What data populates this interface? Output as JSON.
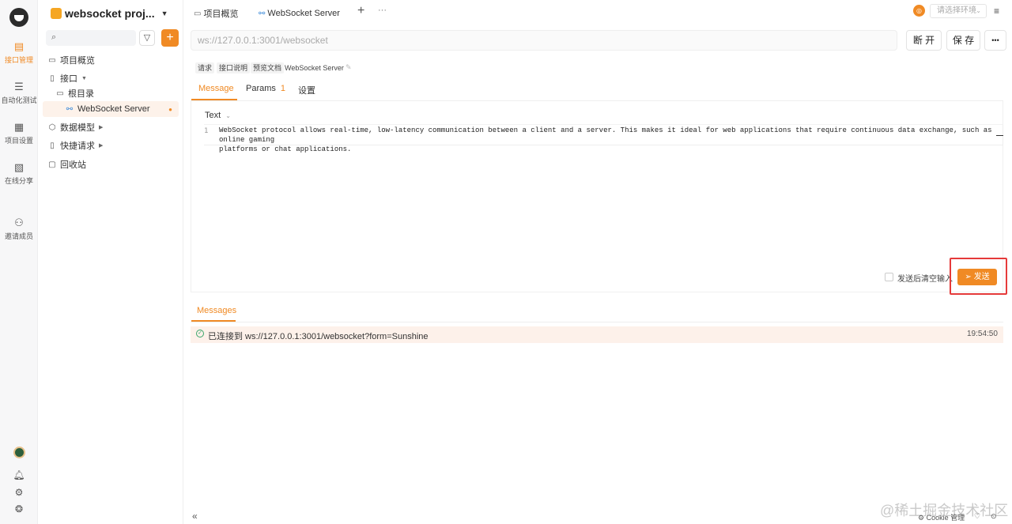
{
  "rail": {
    "items": [
      {
        "label": "接口管理",
        "icon": "api-icon"
      },
      {
        "label": "自动化测试",
        "icon": "automation-icon"
      },
      {
        "label": "项目设置",
        "icon": "settings-icon"
      },
      {
        "label": "在线分享",
        "icon": "share-icon"
      },
      {
        "label": "邀请成员",
        "icon": "invite-icon"
      }
    ],
    "bottom_icons": [
      "bell-icon",
      "gear-icon",
      "help-icon"
    ]
  },
  "sidebar": {
    "project_name": "websocket proj...",
    "tree": [
      {
        "label": "项目概览"
      },
      {
        "label": "接口"
      },
      {
        "label": "根目录"
      },
      {
        "label": "WebSocket Server"
      },
      {
        "label": "数据模型"
      },
      {
        "label": "快捷请求"
      },
      {
        "label": "回收站"
      }
    ]
  },
  "tabs": [
    {
      "label": "项目概览"
    },
    {
      "label": "WebSocket Server"
    }
  ],
  "topbar": {
    "env_placeholder": "请选择环境"
  },
  "request": {
    "url": "ws://127.0.0.1:3001/websocket",
    "disconnect_label": "断 开",
    "save_label": "保 存",
    "more_label": "•••"
  },
  "breadcrumb": {
    "chips": [
      "请求",
      "接口说明",
      "预览文档"
    ],
    "name": "WebSocket Server"
  },
  "subtabs": {
    "message": "Message",
    "params": "Params",
    "params_count": "1",
    "settings": "设置"
  },
  "editor": {
    "format": "Text",
    "line_number": "1",
    "content_line1": "WebSocket protocol allows real-time, low-latency communication between a client and a server. This makes it ideal for web applications that require continuous data exchange, such as online gaming",
    "content_line2": "platforms or chat applications."
  },
  "send": {
    "clear_after_send": "发送后清空输入",
    "clear_checked": false,
    "button_label": "发送"
  },
  "messages": {
    "tab_label": "Messages",
    "rows": [
      {
        "text": "已连接到 ws://127.0.0.1:3001/websocket?form=Sunshine",
        "time": "19:54:50",
        "status": "connected"
      }
    ]
  },
  "footer": {
    "cookie_label": "Cookie 管理",
    "watermark": "@稀土掘金技术社区"
  },
  "colors": {
    "accent": "#f08a24",
    "highlight_frame": "#e53a3a",
    "success": "#3aa66b"
  }
}
